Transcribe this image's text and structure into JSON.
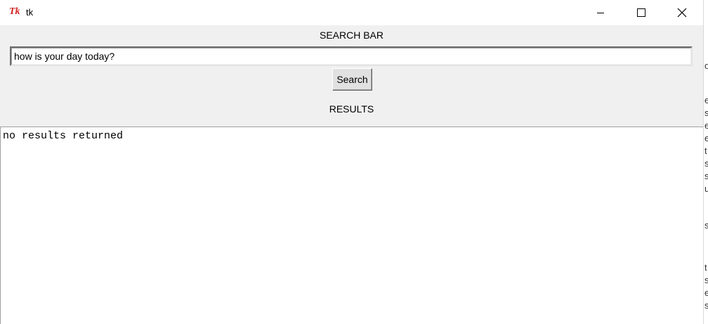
{
  "window": {
    "title": "tk",
    "logo_text": "Tk"
  },
  "search": {
    "heading": "SEARCH BAR",
    "value": "how is your day today?",
    "button_label": "Search"
  },
  "results": {
    "heading": "RESULTS",
    "text": "no results returned"
  },
  "background_window_text": [
    "o",
    "e",
    "s",
    "e",
    "e",
    "t",
    "s",
    "s",
    "u",
    "s",
    "t",
    "s",
    "e",
    "s"
  ]
}
